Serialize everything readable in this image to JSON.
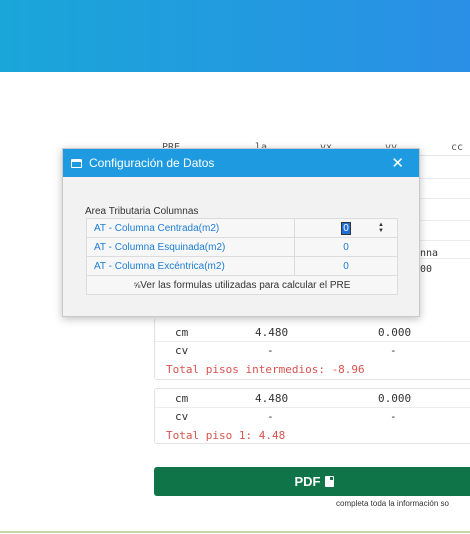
{
  "bg": {
    "header_cols": [
      "PRE",
      "la",
      "vx",
      "vy",
      "cc"
    ],
    "right_fragments": [
      "nna",
      "00"
    ],
    "group_mid": {
      "rows": [
        {
          "label": "cm",
          "v1": "4.480",
          "v2": "0.000"
        },
        {
          "label": "cv",
          "v1": "-",
          "v2": "-"
        }
      ],
      "total": "Total pisos intermedios: -8.96"
    },
    "group_last": {
      "rows": [
        {
          "label": "cm",
          "v1": "4.480",
          "v2": "0.000"
        },
        {
          "label": "cv",
          "v1": "-",
          "v2": "-"
        }
      ],
      "total": "Total piso 1: 4.48"
    },
    "pdf_label": "PDF",
    "hint": "completa toda la información so"
  },
  "dialog": {
    "title": "Configuración de Datos",
    "section": "Area Tributaria Columnas",
    "rows": [
      {
        "label": "AT - Columna Centrada(m2)",
        "value": "0"
      },
      {
        "label": "AT - Columna Esquinada(m2)",
        "value": "0"
      },
      {
        "label": "AT - Columna Excéntrica(m2)",
        "value": "0"
      }
    ],
    "footer": "Ver las formulas utilizadas para calcular el PRE",
    "icons": {
      "window": "window-icon",
      "close": "close-icon",
      "link": "link-icon",
      "spinner": "spinner-icon",
      "pdf": "file-icon"
    }
  }
}
